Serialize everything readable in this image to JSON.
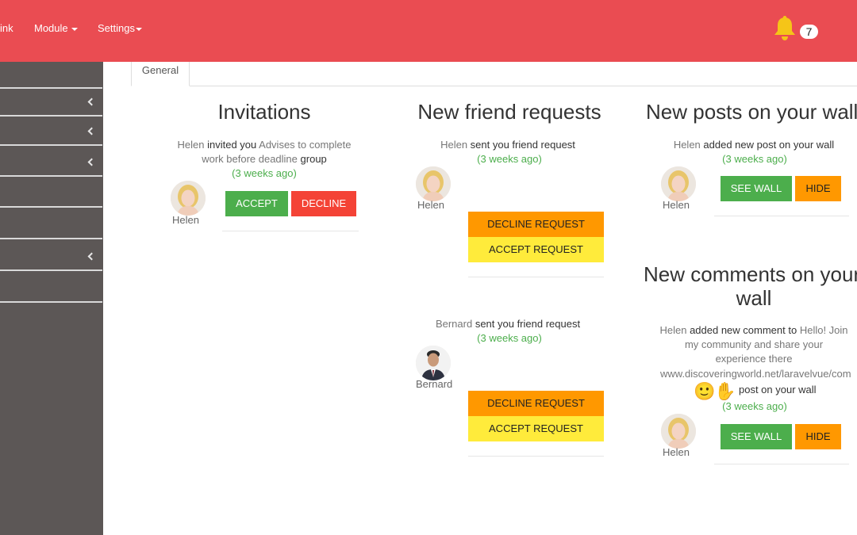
{
  "nav": {
    "link_label": "ink",
    "module_label": "Module",
    "settings_label": "Settings",
    "notification_count": "7"
  },
  "tabs": {
    "general": "General"
  },
  "invitations": {
    "title": "Invitations",
    "who": "Helen",
    "verb": "invited you",
    "target": "Advises to complete",
    "target2": "work before deadline",
    "kind": "group",
    "time": "(3 weeks ago)",
    "avatar_name": "Helen",
    "accept": "ACCEPT",
    "decline": "DECLINE"
  },
  "friend_requests": {
    "title": "New friend requests",
    "items": [
      {
        "who": "Helen",
        "text": "sent you friend request",
        "time": "(3 weeks ago)",
        "avatar_name": "Helen",
        "decline": "DECLINE REQUEST",
        "accept": "ACCEPT REQUEST"
      },
      {
        "who": "Bernard",
        "text": "sent you friend request",
        "time": "(3 weeks ago)",
        "avatar_name": "Bernard",
        "decline": "DECLINE REQUEST",
        "accept": "ACCEPT REQUEST"
      }
    ]
  },
  "wall_posts": {
    "title": "New posts on your wall",
    "who": "Helen",
    "text": "added new post on your wall",
    "time": "(3 weeks ago)",
    "avatar_name": "Helen",
    "see_wall": "SEE WALL",
    "hide": "HIDE"
  },
  "wall_comments": {
    "title_line1": "New comments on your",
    "title_line2": "wall",
    "who": "Helen",
    "text": "added new comment to",
    "post_line1": "Hello! Join",
    "post_line2": "my community and share your",
    "post_line3": "experience there",
    "post_line4": "www.discoveringworld.net/laravelvue/com",
    "suffix": "post on your wall",
    "time": "(3 weeks ago)",
    "avatar_name": "Helen",
    "see_wall": "SEE WALL",
    "hide": "HIDE"
  }
}
